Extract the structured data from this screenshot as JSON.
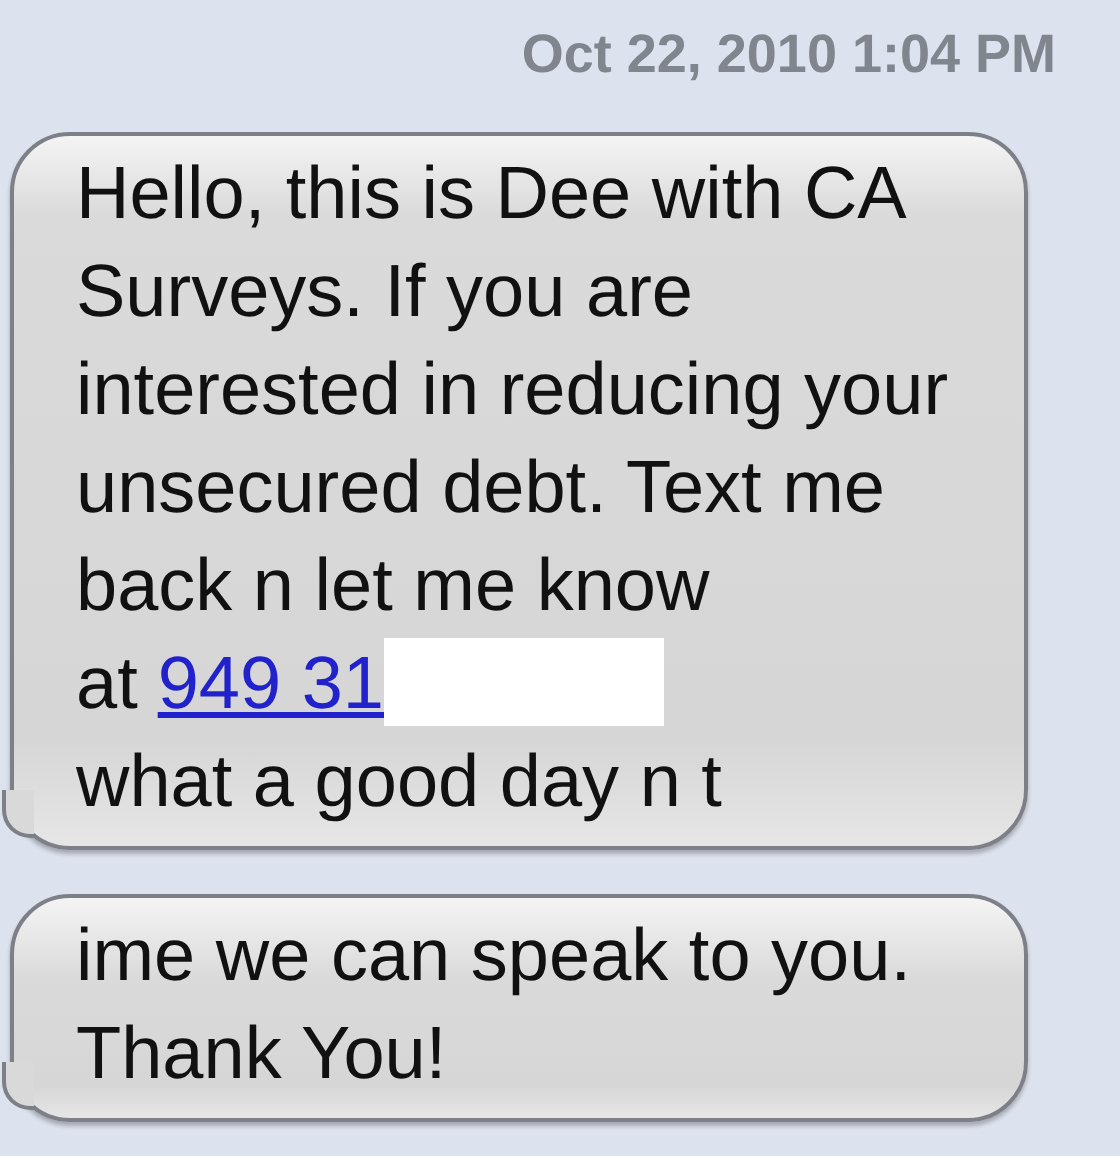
{
  "timestamp": "Oct 22, 2010 1:04 PM",
  "messages": [
    {
      "text": "Hello, this is Dee with CA Surveys. If you are interested in reducing your unsecured debt. Text me back n let me know at",
      "link": "949 31",
      "redacted": true,
      "after": "what a good day n t"
    },
    {
      "text": "ime we can speak to you. Thank You!",
      "redacted": false
    }
  ]
}
